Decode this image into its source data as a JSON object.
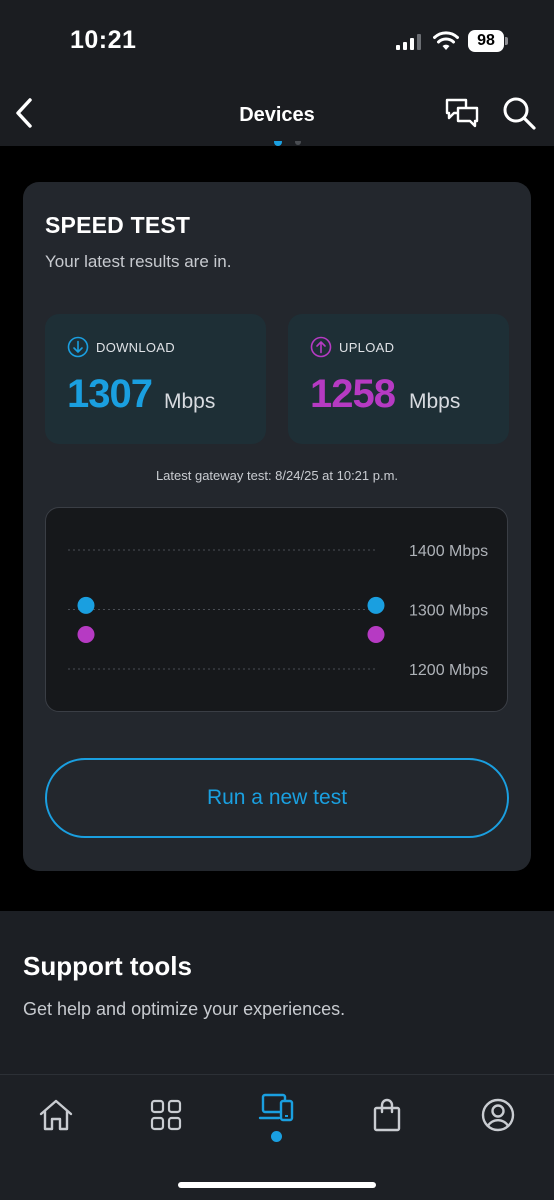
{
  "status_bar": {
    "time": "10:21",
    "battery": "98"
  },
  "header": {
    "title": "Devices"
  },
  "speed_test": {
    "title": "SPEED TEST",
    "subtitle": "Your latest results are in.",
    "download": {
      "label": "DOWNLOAD",
      "value": "1307",
      "unit": "Mbps"
    },
    "upload": {
      "label": "UPLOAD",
      "value": "1258",
      "unit": "Mbps"
    },
    "latest_test": "Latest gateway test: 8/24/25 at 10:21 p.m.",
    "run_button": "Run a new test"
  },
  "chart_data": {
    "type": "scatter",
    "y_ticks": [
      "1400 Mbps",
      "1300 Mbps",
      "1200 Mbps"
    ],
    "ylim": [
      1200,
      1400
    ],
    "series": [
      {
        "name": "DOWNLOAD",
        "color": "#1a9fe0",
        "values": [
          1307,
          1307
        ]
      },
      {
        "name": "UPLOAD",
        "color": "#b63ac3",
        "values": [
          1258,
          1258
        ]
      }
    ]
  },
  "support": {
    "title": "Support tools",
    "subtitle": "Get help and optimize your experiences."
  },
  "tabs": [
    {
      "icon": "home-icon"
    },
    {
      "icon": "grid-icon"
    },
    {
      "icon": "devices-icon",
      "active": true
    },
    {
      "icon": "shopping-bag-icon"
    },
    {
      "icon": "profile-icon"
    }
  ],
  "colors": {
    "accent": "#1a9fe0",
    "upload": "#b63ac3"
  }
}
